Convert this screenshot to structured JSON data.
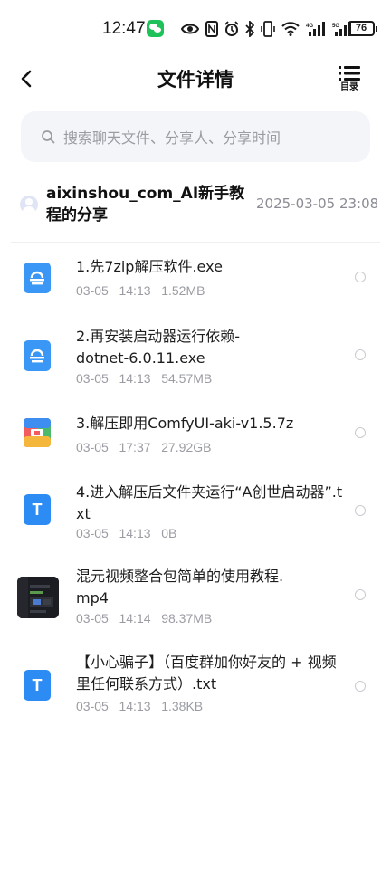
{
  "status_bar": {
    "time": "12:47",
    "battery": "76",
    "signal_labels": [
      "4G",
      "5G"
    ]
  },
  "header": {
    "title": "文件详情",
    "toc_label": "目录",
    "back_icon": "chevron-left-icon",
    "toc_icon": "list-icon"
  },
  "search": {
    "placeholder": "搜索聊天文件、分享人、分享时间"
  },
  "share": {
    "title": "aixinshou_com_AI新手教程的分享",
    "date": "2025-03-05  23:08"
  },
  "files": [
    {
      "name": "1.先7zip解压软件.exe",
      "date": "03-05",
      "time": "14:13",
      "size": "1.52MB",
      "icon": "exe-file-icon"
    },
    {
      "name": "2.再安装启动器运行依赖-dotnet-6.0.11.exe",
      "date": "03-05",
      "time": "14:13",
      "size": "54.57MB",
      "icon": "exe-file-icon"
    },
    {
      "name": "3.解压即用ComfyUI-aki-v1.5.7z",
      "date": "03-05",
      "time": "17:37",
      "size": "27.92GB",
      "icon": "archive-file-icon"
    },
    {
      "name": "4.进入解压后文件夹运行“A创世启动器”.txt",
      "date": "03-05",
      "time": "14:13",
      "size": "0B",
      "icon": "text-file-icon",
      "icon_letter": "T"
    },
    {
      "name": "混元视频整合包简单的使用教程.mp4",
      "date": "03-05",
      "time": "14:14",
      "size": "98.37MB",
      "icon": "video-thumbnail"
    },
    {
      "name": "【小心骗子】（百度群加你好友的 + 视频里任何联系方式）.txt",
      "date": "03-05",
      "time": "14:13",
      "size": "1.38KB",
      "icon": "text-file-icon",
      "icon_letter": "T"
    }
  ],
  "colors": {
    "accent_blue": "#2c8cf4",
    "search_bg": "#f4f5f9",
    "meta_gray": "#9a9ca3"
  }
}
